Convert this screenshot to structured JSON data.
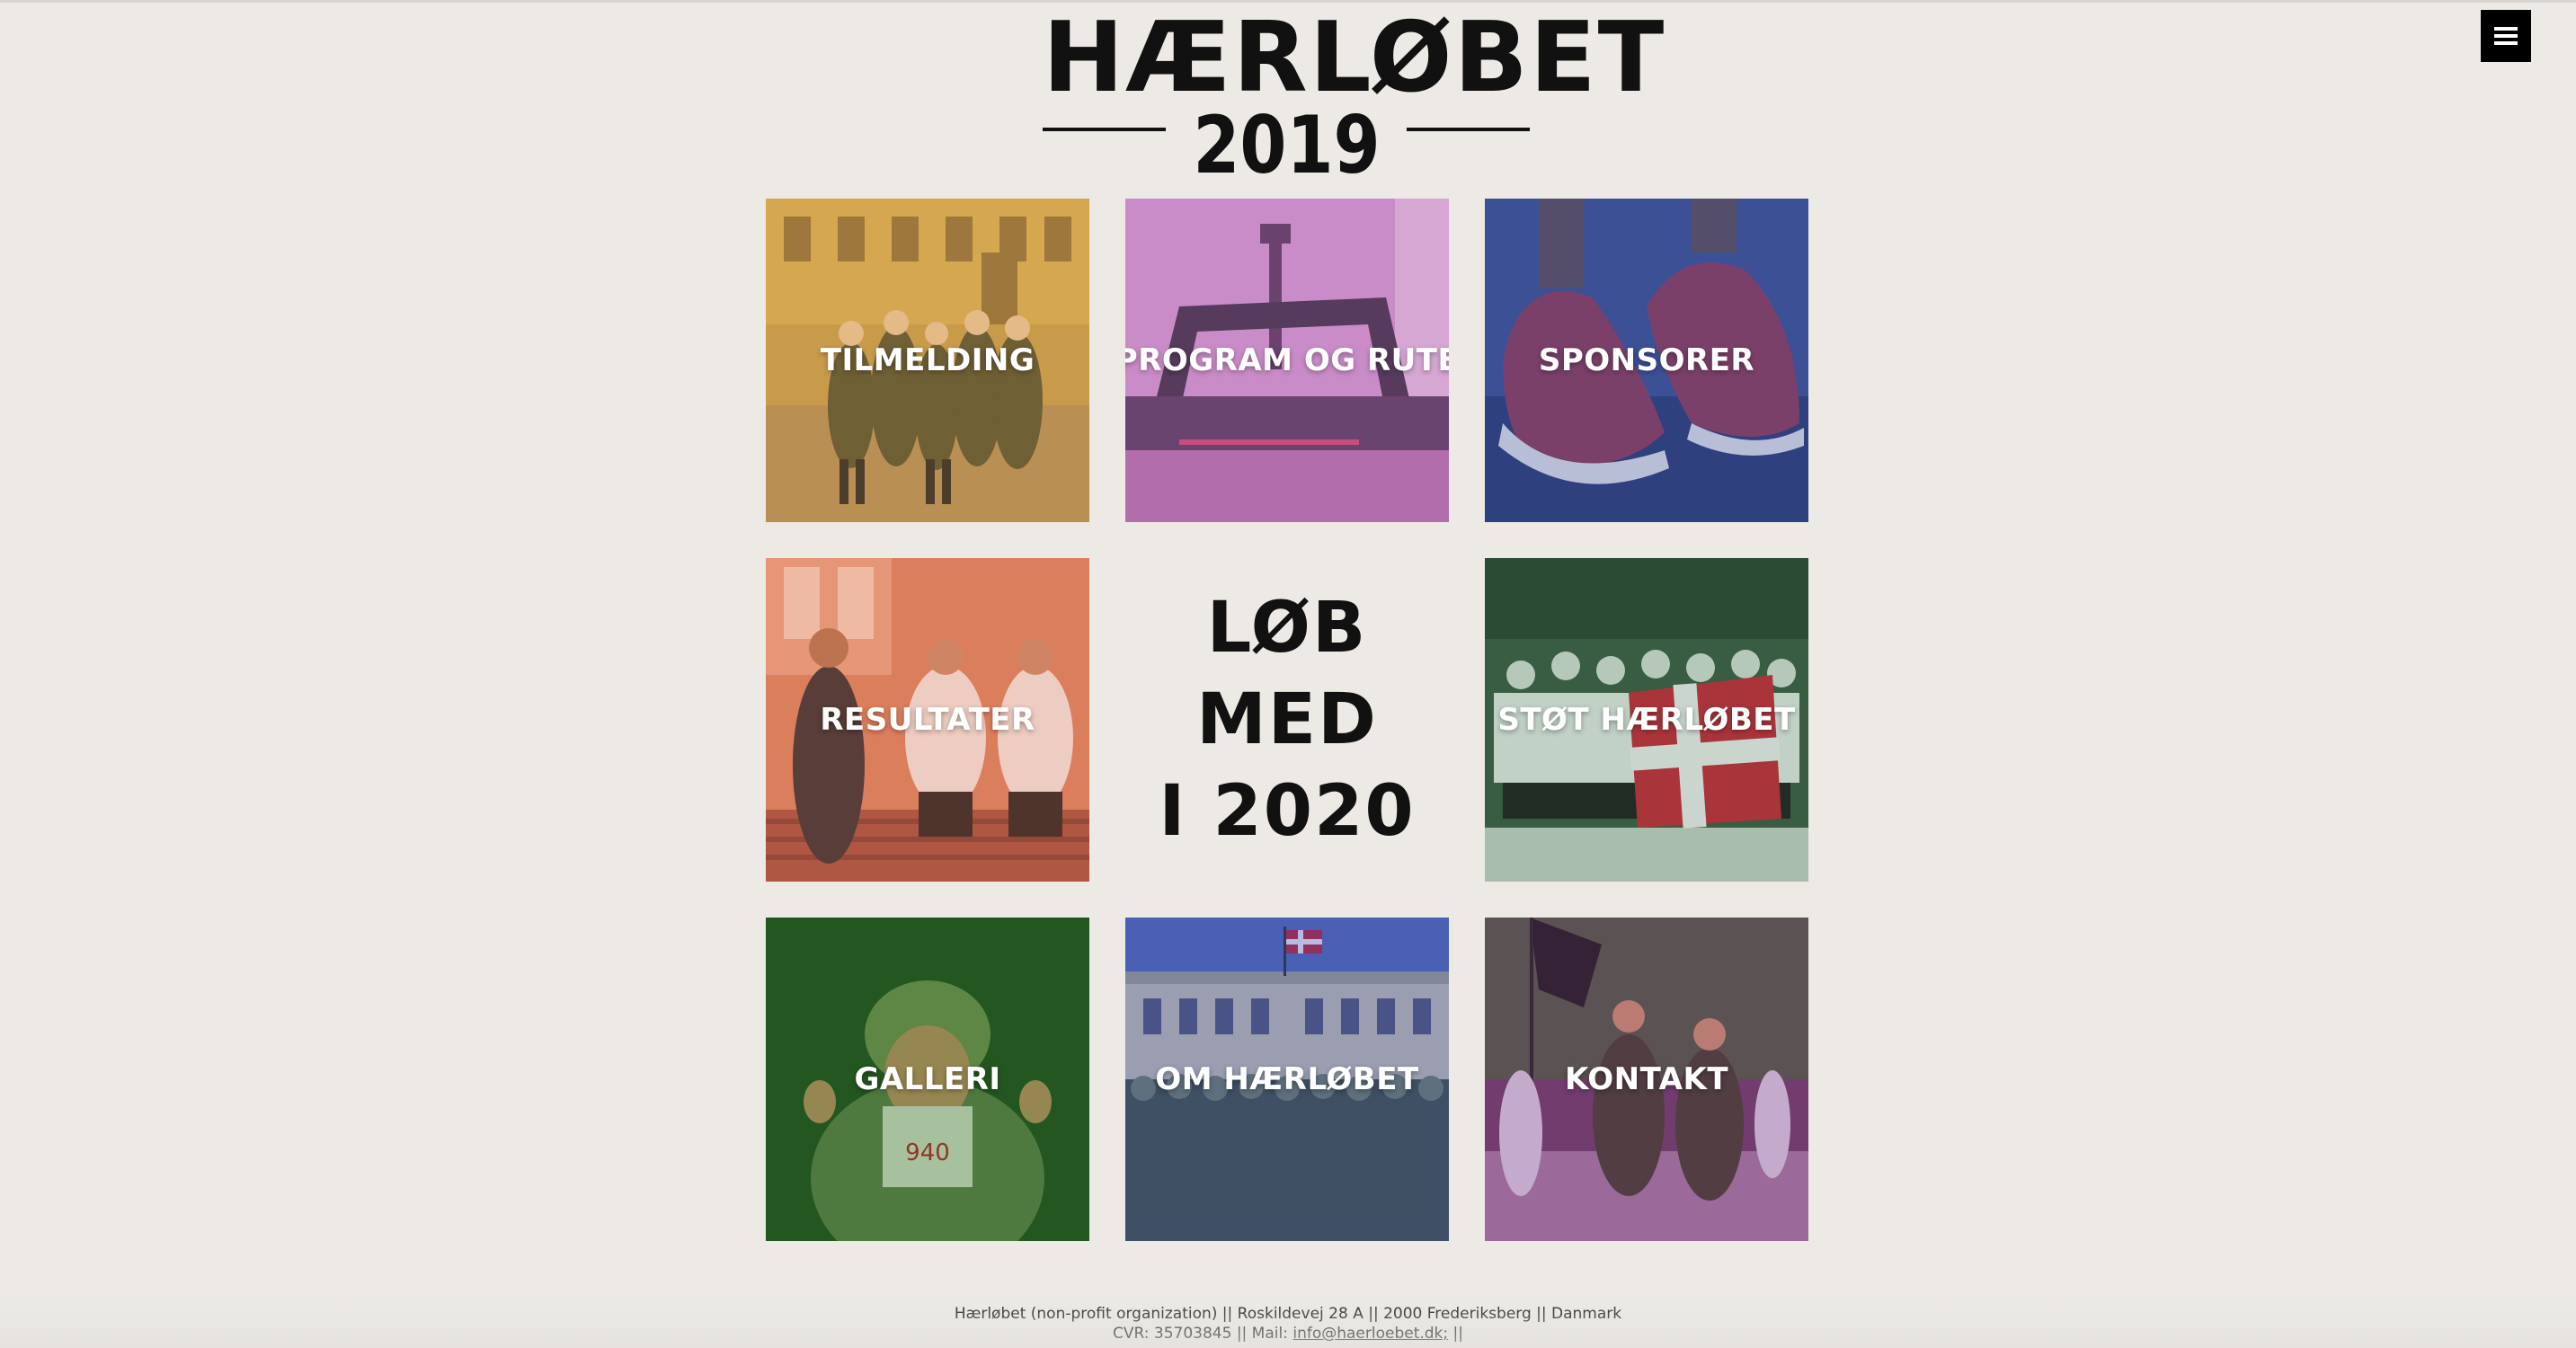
{
  "logo": {
    "title": "HÆRLØBET",
    "year": "2019"
  },
  "menu": {
    "icon": "hamburger-menu-icon"
  },
  "tiles": [
    {
      "label": "TILMELDING",
      "overlay": "#c8963c"
    },
    {
      "label": "PROGRAM OG RUTE",
      "overlay": "#b05aa8"
    },
    {
      "label": "SPONSORER",
      "overlay": "#3a4f9a"
    },
    {
      "label": "RESULTATER",
      "overlay": "#d8704f"
    },
    {
      "label": "STØT HÆRLØBET",
      "overlay": "#2f5a36"
    },
    {
      "label": "GALLERI",
      "overlay": "#2e6a2a"
    },
    {
      "label": "OM HÆRLØBET",
      "overlay": "#2f3f8f"
    },
    {
      "label": "KONTAKT",
      "overlay": "#7a3f7a"
    }
  ],
  "center": {
    "line1": "LØB MED",
    "line2": "I 2020"
  },
  "footer": {
    "line1": "Hærløbet (non-profit organization) || Roskildevej 28 A || 2000 Frederiksberg || Danmark",
    "line2_prefix": "CVR: 35703845 || Mail:",
    "email": "info@haerloebet.dk;",
    "line2_suffix": "||"
  }
}
